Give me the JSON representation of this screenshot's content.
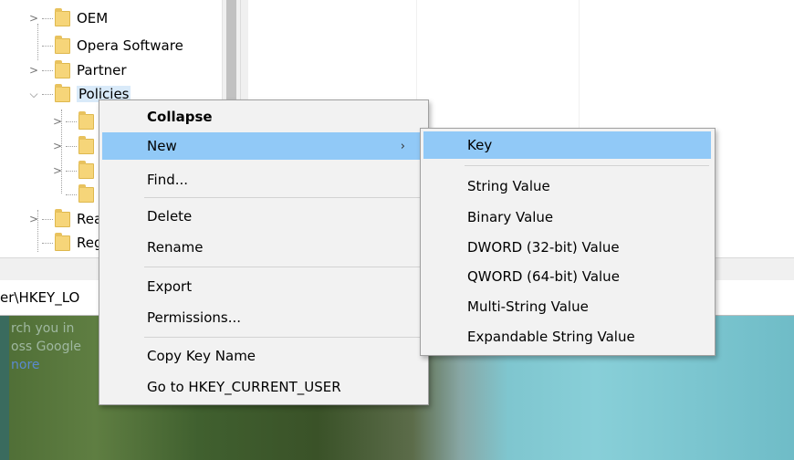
{
  "tree": {
    "items": [
      {
        "label": "OEM"
      },
      {
        "label": "Opera Software"
      },
      {
        "label": "Partner"
      },
      {
        "label": "Policies"
      },
      {
        "label": "Rea"
      },
      {
        "label": "Reg"
      }
    ]
  },
  "address": {
    "path": "er\\HKEY_LO"
  },
  "wallpaper": {
    "ghost_lines": [
      "rch you in",
      "oss Google",
      "nore"
    ]
  },
  "context_menu": {
    "collapse": "Collapse",
    "new": "New",
    "new_arrow": "›",
    "find": "Find...",
    "delete": "Delete",
    "rename": "Rename",
    "export": "Export",
    "permissions": "Permissions...",
    "copy_key_name": "Copy Key Name",
    "goto": "Go to HKEY_CURRENT_USER"
  },
  "submenu": {
    "key": "Key",
    "string_value": "String Value",
    "binary_value": "Binary Value",
    "dword": "DWORD (32-bit) Value",
    "qword": "QWORD (64-bit) Value",
    "multi_string": "Multi-String Value",
    "expandable_string": "Expandable String Value"
  },
  "colors": {
    "highlight": "#91c9f7",
    "menu_bg": "#f2f2f2",
    "folder": "#f6d579"
  }
}
